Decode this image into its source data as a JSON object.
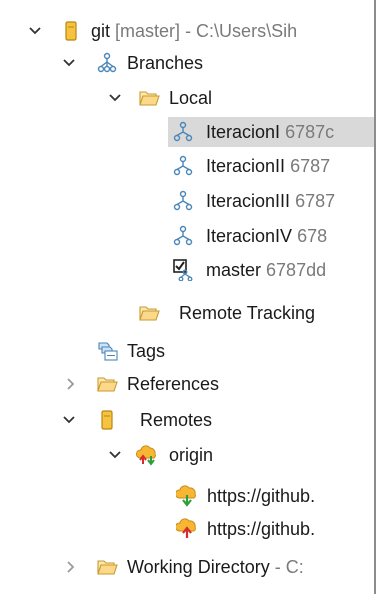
{
  "tree": {
    "repo": {
      "name": "git",
      "branch": "[master]",
      "path": "- C:\\Users\\Sih"
    },
    "branches_label": "Branches",
    "local_label": "Local",
    "local_branches": [
      {
        "name": "IteracionI",
        "commit": "6787c"
      },
      {
        "name": "IteracionII",
        "commit": "6787"
      },
      {
        "name": "IteracionIII",
        "commit": "6787"
      },
      {
        "name": "IteracionIV",
        "commit": "678"
      },
      {
        "name": "master",
        "commit": "6787dd"
      }
    ],
    "remote_tracking_label": "Remote Tracking",
    "tags_label": "Tags",
    "references_label": "References",
    "remotes_label": "Remotes",
    "origin_label": "origin",
    "remote_urls": [
      {
        "url": "https://github."
      },
      {
        "url": "https://github."
      }
    ],
    "working_directory": {
      "label": "Working Directory",
      "path": "- C:"
    }
  },
  "colors": {
    "selection": "#d9d9d9",
    "folder_fill": "#fcd98a",
    "folder_stroke": "#c99a2e",
    "repo_fill": "#f5c242",
    "branch_icon": "#4a86b8",
    "dim_text": "#7a7a7a"
  }
}
